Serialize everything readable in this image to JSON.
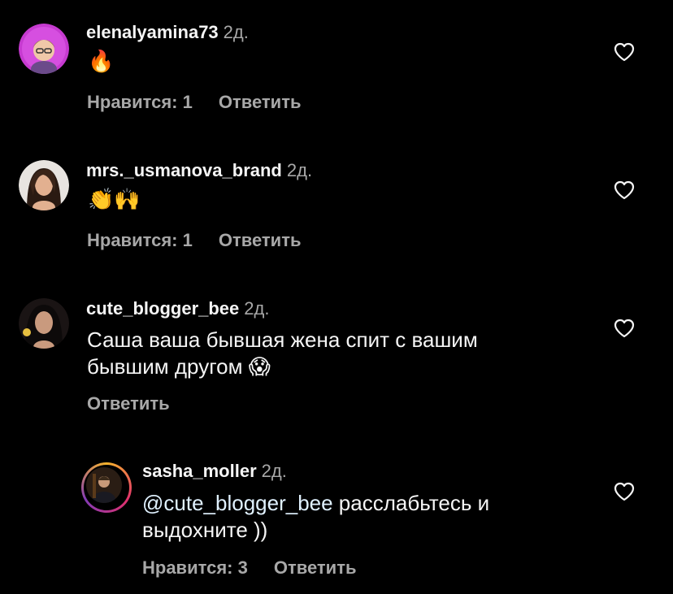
{
  "comments": [
    {
      "username": "elenalyamina73",
      "time": "2д.",
      "text": "🔥",
      "likes_label": "Нравится: 1",
      "reply_label": "Ответить"
    },
    {
      "username": "mrs._usmanova_brand",
      "time": "2д.",
      "text": "👏🙌",
      "likes_label": "Нравится: 1",
      "reply_label": "Ответить"
    },
    {
      "username": "cute_blogger_bee",
      "time": "2д.",
      "text_line1": "Саша ваша бывшая жена спит с вашим",
      "text_line2": "бывшим другом",
      "text_emoji": "😱",
      "reply_label": "Ответить"
    },
    {
      "username": "sasha_moller",
      "time": "2д.",
      "mention": "@cute_blogger_bee",
      "text_line1_rest": " расслабьтесь и",
      "text_line2": "выдохните ))",
      "likes_label": "Нравится: 3",
      "reply_label": "Ответить"
    }
  ],
  "colors": {
    "background": "#000000",
    "text_primary": "#f5f5f5",
    "text_secondary": "#a8a8a8",
    "mention": "#e0f1ff"
  },
  "icons": {
    "like": "heart-outline-icon"
  }
}
